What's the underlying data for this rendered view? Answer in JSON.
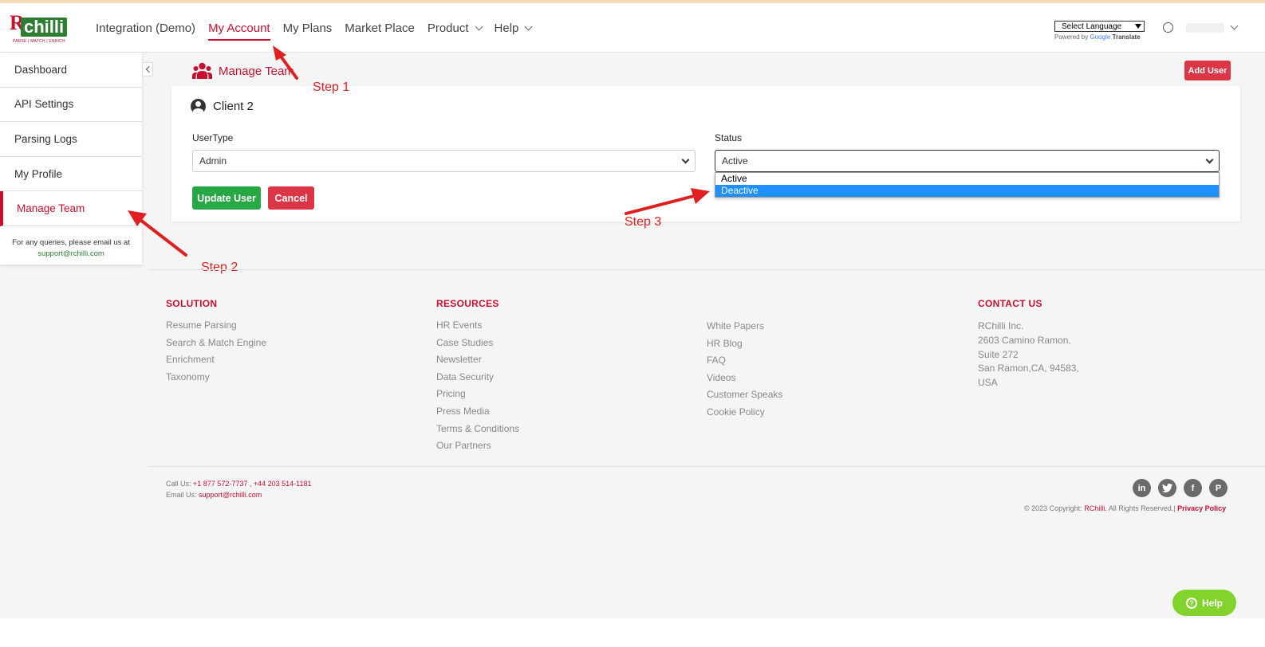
{
  "header": {
    "logo": {
      "mark": "R",
      "word": "chilli",
      "tagline": "PARSE | MATCH | ENRICH"
    },
    "nav": [
      {
        "label": "Integration (Demo)",
        "active": false,
        "dropdown": false
      },
      {
        "label": "My Account",
        "active": true,
        "dropdown": false
      },
      {
        "label": "My Plans",
        "active": false,
        "dropdown": false
      },
      {
        "label": "Market Place",
        "active": false,
        "dropdown": false
      },
      {
        "label": "Product",
        "active": false,
        "dropdown": true
      },
      {
        "label": "Help",
        "active": false,
        "dropdown": true
      }
    ],
    "language": {
      "select_label": "Select Language",
      "powered_by": "Powered by",
      "google": "Google",
      "translate": "Translate"
    }
  },
  "sidebar": {
    "items": [
      {
        "label": "Dashboard",
        "active": false
      },
      {
        "label": "API Settings",
        "active": false
      },
      {
        "label": "Parsing Logs",
        "active": false
      },
      {
        "label": "My Profile",
        "active": false
      },
      {
        "label": "Manage Team",
        "active": true
      }
    ],
    "note": "For any queries, please email us at",
    "email": "support@rchilli.com"
  },
  "main": {
    "title": "Manage Team",
    "add_user_label": "Add User",
    "client_name": "Client 2",
    "usertype_label": "UserType",
    "usertype_value": "Admin",
    "status_label": "Status",
    "status_value": "Active",
    "status_options": [
      {
        "label": "Active",
        "highlighted": false
      },
      {
        "label": "Deactive",
        "highlighted": true
      }
    ],
    "update_label": "Update User",
    "cancel_label": "Cancel"
  },
  "annotations": {
    "step1": "Step 1",
    "step2": "Step 2",
    "step3": "Step 3",
    "arrow_color": "#e02020"
  },
  "footer": {
    "solution": {
      "title": "SOLUTION",
      "links": [
        "Resume Parsing",
        "Search & Match Engine",
        "Enrichment",
        "Taxonomy"
      ]
    },
    "resources": {
      "title": "RESOURCES",
      "links": [
        "HR Events",
        "Case Studies",
        "Newsletter",
        "Data Security",
        "Pricing",
        "Press Media",
        "Terms & Conditions",
        "Our Partners"
      ]
    },
    "more": {
      "links": [
        "White Papers",
        "HR Blog",
        "FAQ",
        "Videos",
        "Customer Speaks",
        "Cookie Policy"
      ]
    },
    "contact": {
      "title": "CONTACT US",
      "lines": [
        "RChilli Inc.",
        "2603 Camino Ramon,",
        "Suite 272",
        "San Ramon,CA, 94583,",
        "USA"
      ]
    },
    "call_label": "Call Us:",
    "phones": "+1 877 572-7737 , +44 203 514-1181",
    "email_label": "Email Us:",
    "email": "support@rchilli.com",
    "social": [
      "linkedin-icon",
      "twitter-icon",
      "facebook-icon",
      "pinterest-icon"
    ],
    "copyright_prefix": "© 2023 Copyright:",
    "brand": "RChilli.",
    "rights": "All Rights Reserved.|",
    "privacy": "Privacy Policy"
  },
  "help_widget": {
    "label": "Help"
  },
  "colors": {
    "brand_red": "#c8102e",
    "brand_green": "#2e7d32",
    "highlight": "#1e90ff",
    "help": "#82d42c"
  }
}
